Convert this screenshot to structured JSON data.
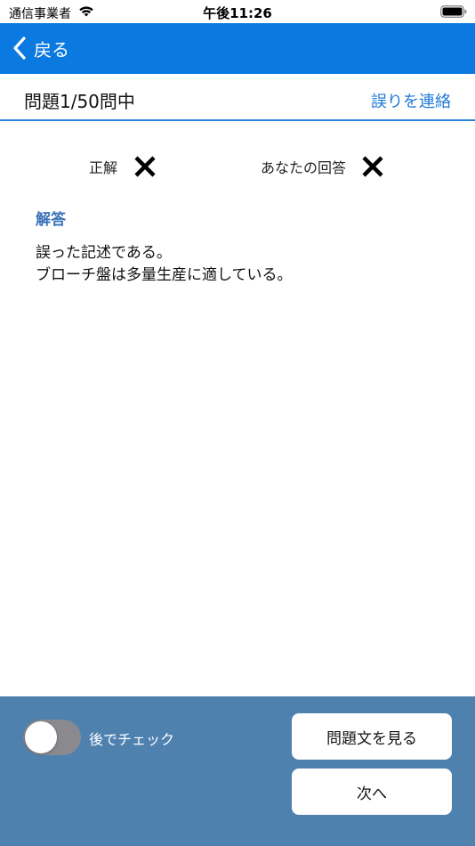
{
  "status_bar": {
    "carrier": "通信事業者",
    "time": "午後11:26",
    "wifi_icon": "wifi-icon",
    "battery_icon": "battery-icon"
  },
  "nav": {
    "back_label": "戻る",
    "back_icon": "chevron-left-icon",
    "bar_color": "#0a7ae0"
  },
  "question_bar": {
    "counter": "問題1/50問中",
    "report_label": "誤りを連絡",
    "link_color": "#1f7ad8"
  },
  "result": {
    "correct_label": "正解",
    "correct_mark": "✕",
    "your_answer_label": "あなたの回答",
    "your_mark": "✕"
  },
  "explanation": {
    "heading": "解答",
    "lines": [
      "誤った記述である。",
      "ブローチ盤は多量生産に適している。"
    ],
    "heading_color": "#3a72b8"
  },
  "bottom": {
    "toggle_label": "後でチェック",
    "toggle_on": false,
    "view_question_label": "問題文を見る",
    "next_label": "次へ",
    "panel_color": "#4f81af"
  }
}
